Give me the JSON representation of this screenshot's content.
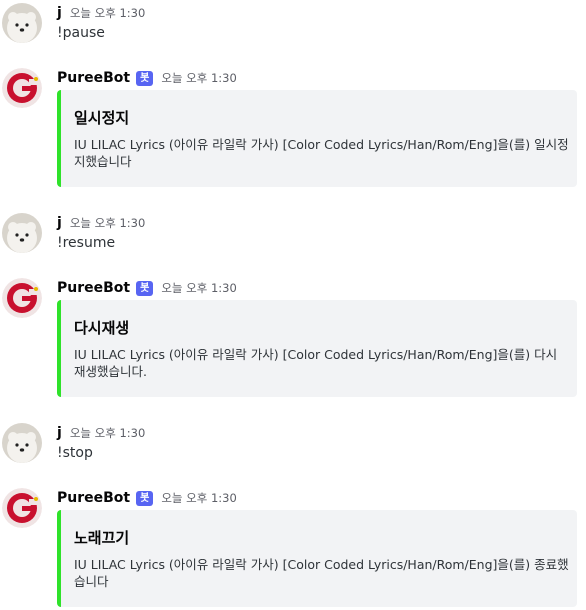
{
  "messages": [
    {
      "author": "j",
      "timestamp": "오늘 오후 1:30",
      "text": "!pause"
    },
    {
      "author": "PureeBot",
      "badge": "봇",
      "timestamp": "오늘 오후 1:30",
      "embed": {
        "title": "일시정지",
        "description": "IU LILAC Lyrics (아이유 라일락 가사) [Color Coded Lyrics/Han/Rom/Eng]을(를) 일시정지했습니다",
        "accent_color": "#2fe22a"
      }
    },
    {
      "author": "j",
      "timestamp": "오늘 오후 1:30",
      "text": "!resume"
    },
    {
      "author": "PureeBot",
      "badge": "봇",
      "timestamp": "오늘 오후 1:30",
      "embed": {
        "title": "다시재생",
        "description": "IU LILAC Lyrics (아이유 라일락 가사) [Color Coded Lyrics/Han/Rom/Eng]을(를) 다시 재생했습니다.",
        "accent_color": "#2fe22a"
      }
    },
    {
      "author": "j",
      "timestamp": "오늘 오후 1:30",
      "text": "!stop"
    },
    {
      "author": "PureeBot",
      "badge": "봇",
      "timestamp": "오늘 오후 1:30",
      "embed": {
        "title": "노래끄기",
        "description": "IU LILAC Lyrics (아이유 라일락 가사) [Color Coded Lyrics/Han/Rom/Eng]을(를) 종료했습니다",
        "accent_color": "#2fe22a"
      }
    }
  ],
  "colors": {
    "bot_badge": "#5865f2",
    "embed_background": "#f2f3f5",
    "user_avatar": "bear-avatar",
    "bot_avatar": "red-g-logo-avatar"
  }
}
